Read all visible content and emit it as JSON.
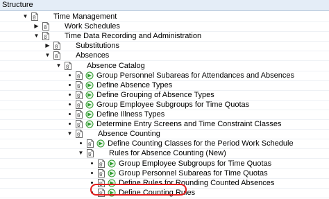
{
  "header": {
    "title": "Structure"
  },
  "rows": [
    {
      "kind": "expanded",
      "level": 0,
      "exec": false,
      "label": "Time Management"
    },
    {
      "kind": "collapsed",
      "level": 1,
      "exec": false,
      "label": "Work Schedules"
    },
    {
      "kind": "expanded",
      "level": 1,
      "exec": false,
      "label": "Time Data Recording and Administration"
    },
    {
      "kind": "collapsed",
      "level": 2,
      "exec": false,
      "label": "Substitutions"
    },
    {
      "kind": "expanded",
      "level": 2,
      "exec": false,
      "label": "Absences"
    },
    {
      "kind": "expanded",
      "level": 3,
      "exec": false,
      "label": "Absence Catalog"
    },
    {
      "kind": "leaf",
      "level": 4,
      "exec": true,
      "label": "Group Personnel Subareas for Attendances and Absences"
    },
    {
      "kind": "leaf",
      "level": 4,
      "exec": true,
      "label": "Define Absence Types"
    },
    {
      "kind": "leaf",
      "level": 4,
      "exec": true,
      "label": "Define Grouping of Absence Types"
    },
    {
      "kind": "leaf",
      "level": 4,
      "exec": true,
      "label": "Group Employee Subgroups for Time Quotas"
    },
    {
      "kind": "leaf",
      "level": 4,
      "exec": true,
      "label": "Define Illness Types"
    },
    {
      "kind": "leaf",
      "level": 4,
      "exec": true,
      "label": "Determine Entry Screens and Time Constraint Classes"
    },
    {
      "kind": "expanded",
      "level": 4,
      "exec": false,
      "label": "Absence Counting"
    },
    {
      "kind": "leaf",
      "level": 5,
      "exec": true,
      "label": "Define Counting Classes for the Period Work Schedule"
    },
    {
      "kind": "expanded",
      "level": 5,
      "exec": false,
      "label": "Rules for Absence Counting (New)"
    },
    {
      "kind": "leaf",
      "level": 6,
      "exec": true,
      "label": "Group Employee Subgroups for Time Quotas"
    },
    {
      "kind": "leaf",
      "level": 6,
      "exec": true,
      "label": "Group Personnel Subareas for Time Quotas"
    },
    {
      "kind": "leaf",
      "level": 6,
      "exec": true,
      "label": "Define Rules for Rounding Counted Absences"
    },
    {
      "kind": "leaf",
      "level": 6,
      "exec": true,
      "label": "Define Counting Rules",
      "highlighted": true
    }
  ],
  "colors": {
    "header_bg": "#e4edf7",
    "exec_icon": "#2e9b2e",
    "highlight_ring": "#e21b1b",
    "doc_icon": "#6b6b6b"
  }
}
